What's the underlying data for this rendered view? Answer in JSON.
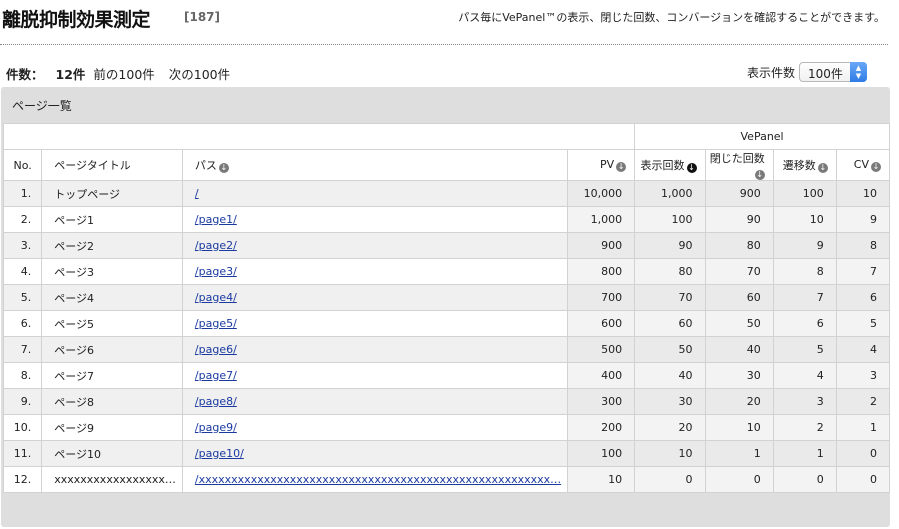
{
  "header": {
    "title": "離脱抑制効果測定",
    "count_badge": "[187]",
    "description": "パス毎にVePanel™の表示、閉じた回数、コンバージョンを確認することができます。"
  },
  "summary": {
    "count_label": "件数：",
    "count_value": "12件",
    "prev_link": "前の100件",
    "next_link": "次の100件"
  },
  "perpage": {
    "label": "表示件数",
    "selected": "100件"
  },
  "panel": {
    "title": "ページ一覧"
  },
  "table": {
    "group_header": "VePanel",
    "columns": {
      "no": "No.",
      "title": "ページタイトル",
      "path": "パス",
      "pv": "PV",
      "shown": "表示回数",
      "closed": "閉じた回数",
      "transitions": "遷移数",
      "cv": "CV"
    },
    "rows": [
      {
        "no": "1.",
        "title": "トップページ",
        "path": "/",
        "pv": "10,000",
        "shown": "1,000",
        "closed": "900",
        "transitions": "100",
        "cv": "10"
      },
      {
        "no": "2.",
        "title": "ページ1",
        "path": "/page1/",
        "pv": "1,000",
        "shown": "100",
        "closed": "90",
        "transitions": "10",
        "cv": "9"
      },
      {
        "no": "3.",
        "title": "ページ2",
        "path": "/page2/",
        "pv": "900",
        "shown": "90",
        "closed": "80",
        "transitions": "9",
        "cv": "8"
      },
      {
        "no": "4.",
        "title": "ページ3",
        "path": "/page3/",
        "pv": "800",
        "shown": "80",
        "closed": "70",
        "transitions": "8",
        "cv": "7"
      },
      {
        "no": "5.",
        "title": "ページ4",
        "path": "/page4/",
        "pv": "700",
        "shown": "70",
        "closed": "60",
        "transitions": "7",
        "cv": "6"
      },
      {
        "no": "6.",
        "title": "ページ5",
        "path": "/page5/",
        "pv": "600",
        "shown": "60",
        "closed": "50",
        "transitions": "6",
        "cv": "5"
      },
      {
        "no": "7.",
        "title": "ページ6",
        "path": "/page6/",
        "pv": "500",
        "shown": "50",
        "closed": "40",
        "transitions": "5",
        "cv": "4"
      },
      {
        "no": "8.",
        "title": "ページ7",
        "path": "/page7/",
        "pv": "400",
        "shown": "40",
        "closed": "30",
        "transitions": "4",
        "cv": "3"
      },
      {
        "no": "9.",
        "title": "ページ8",
        "path": "/page8/",
        "pv": "300",
        "shown": "30",
        "closed": "20",
        "transitions": "3",
        "cv": "2"
      },
      {
        "no": "10.",
        "title": "ページ9",
        "path": "/page9/",
        "pv": "200",
        "shown": "20",
        "closed": "10",
        "transitions": "2",
        "cv": "1"
      },
      {
        "no": "11.",
        "title": "ページ10",
        "path": "/page10/",
        "pv": "100",
        "shown": "10",
        "closed": "1",
        "transitions": "1",
        "cv": "0"
      },
      {
        "no": "12.",
        "title": "xxxxxxxxxxxxxxxxx…",
        "path": "/xxxxxxxxxxxxxxxxxxxxxxxxxxxxxxxxxxxxxxxxxxxxxxxxxxxxxx…",
        "pv": "10",
        "shown": "0",
        "closed": "0",
        "transitions": "0",
        "cv": "0"
      }
    ]
  }
}
